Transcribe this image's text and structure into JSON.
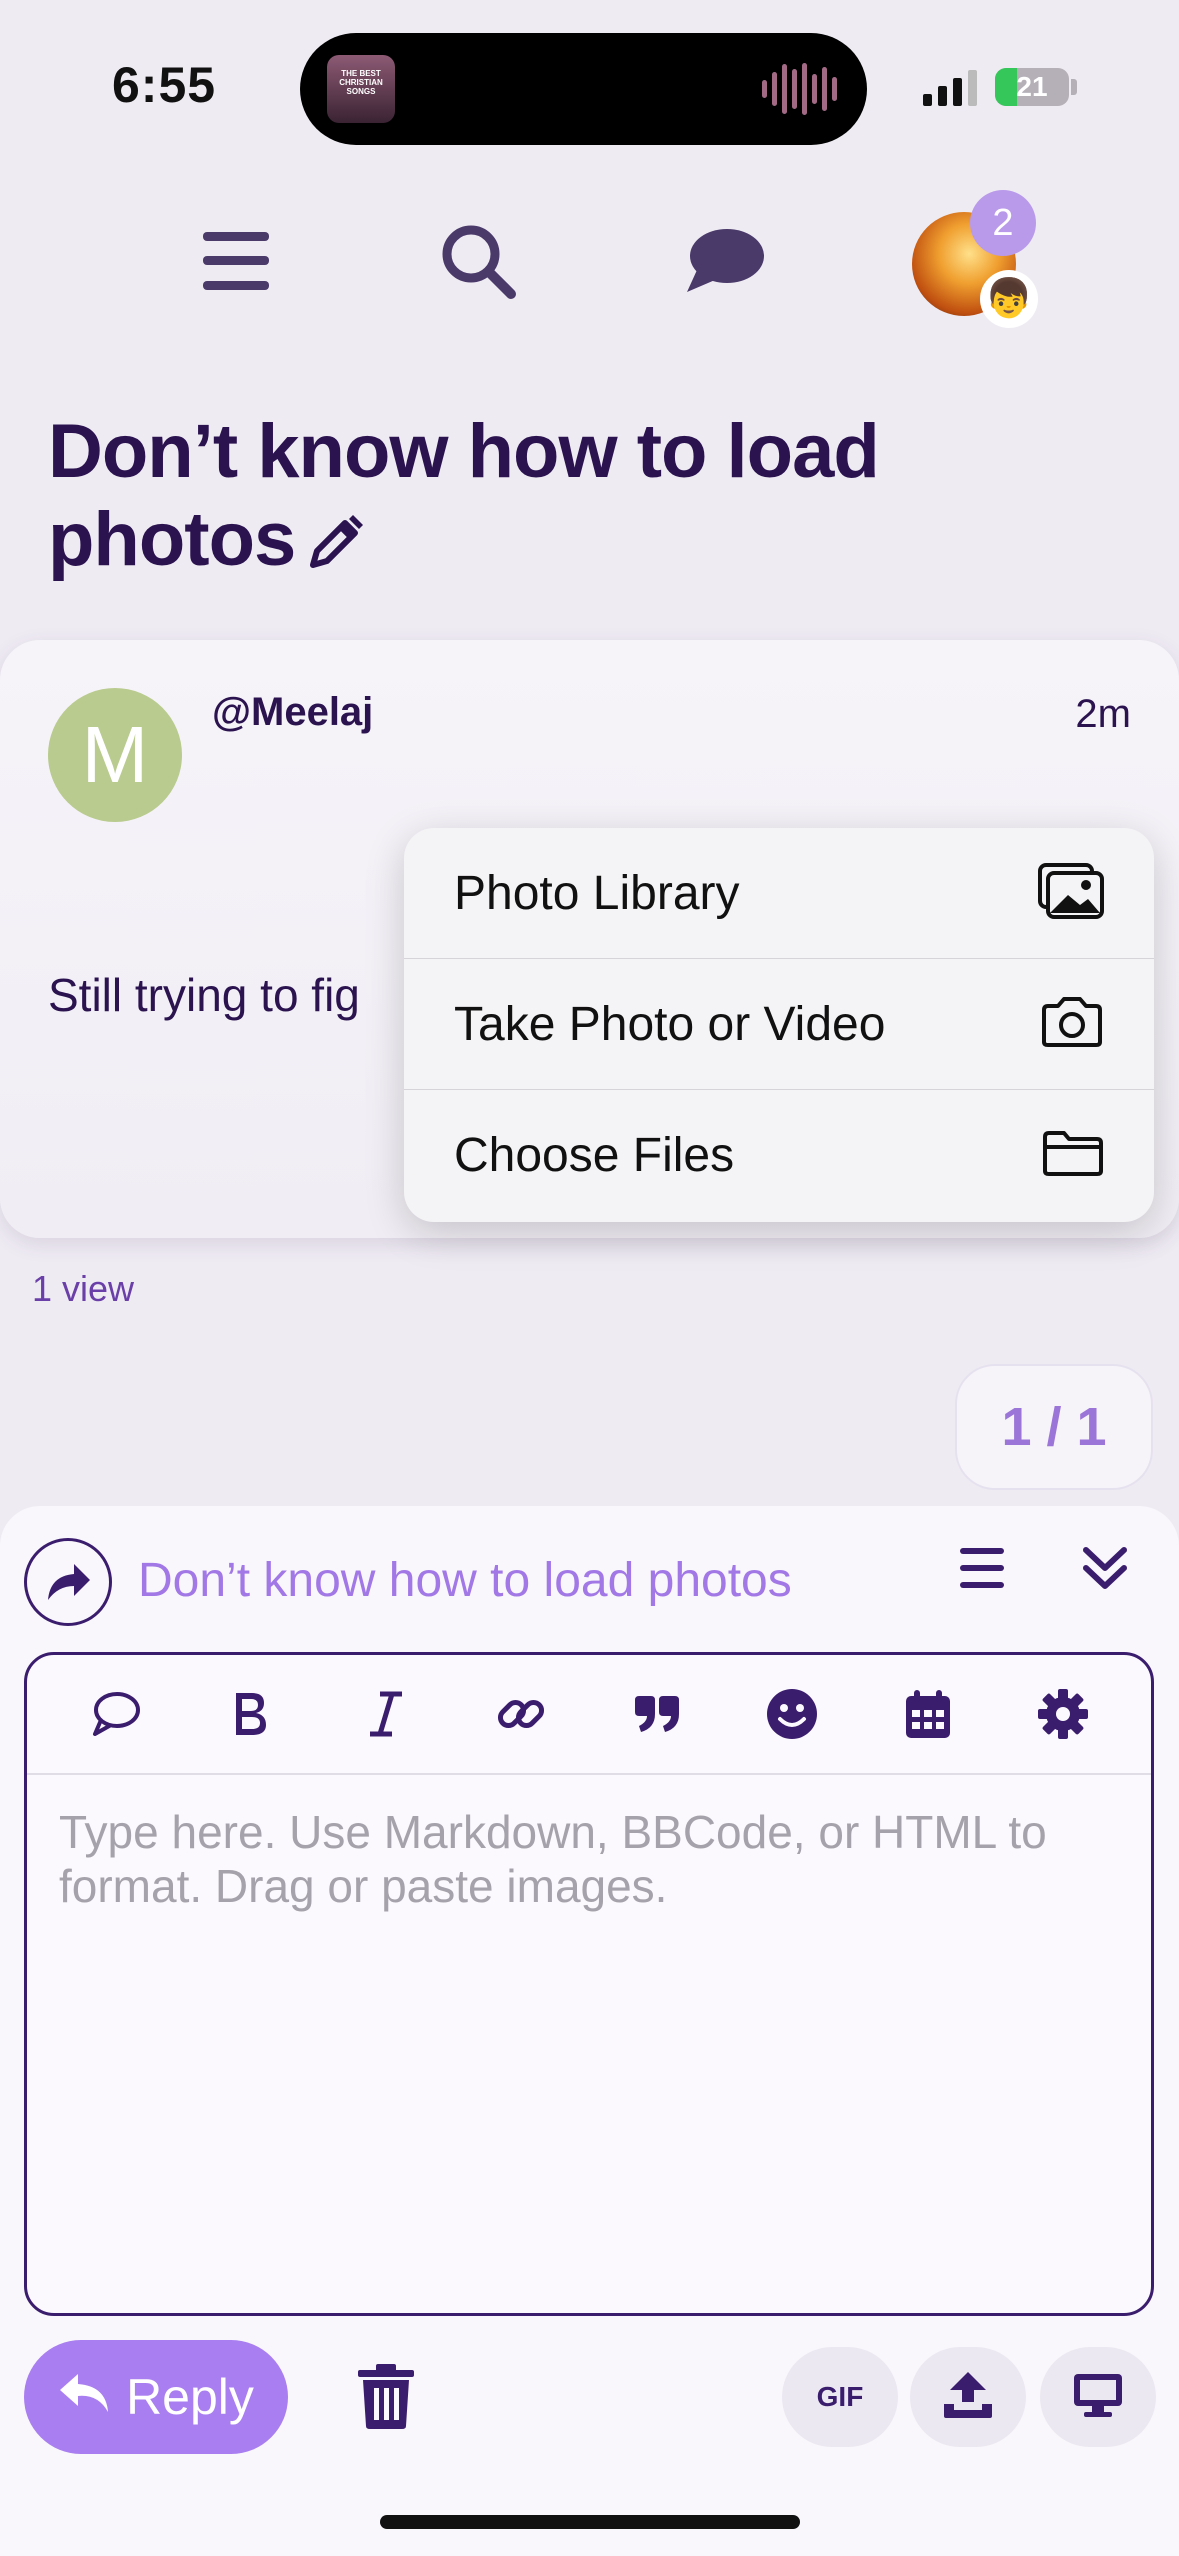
{
  "status_bar": {
    "time": "6:55",
    "battery": "21",
    "album_art_text": "THE BEST CHRISTIAN SONGS"
  },
  "nav": {
    "notification_count": "2",
    "user_badge_emoji": "👦"
  },
  "topic": {
    "title": "Don’t know how to load photos"
  },
  "post": {
    "avatar_letter": "M",
    "avatar_color": "#b9cb8e",
    "username": "@Meelaj",
    "time_ago": "2m",
    "body_visible": "Still trying to fig",
    "views": "1 view"
  },
  "attach_menu": {
    "items": [
      {
        "label": "Photo Library",
        "icon": "photo-library-icon"
      },
      {
        "label": "Take Photo or Video",
        "icon": "camera-icon"
      },
      {
        "label": "Choose Files",
        "icon": "folder-icon"
      }
    ]
  },
  "pager": {
    "text": "1 / 1"
  },
  "composer": {
    "reply_to_title": "Don’t know how to load photos",
    "placeholder": "Type here. Use Markdown, BBCode, or HTML to format. Drag or paste images.",
    "reply_label": "Reply",
    "gif_label": "GIF",
    "accent_color": "#a97ef0"
  }
}
